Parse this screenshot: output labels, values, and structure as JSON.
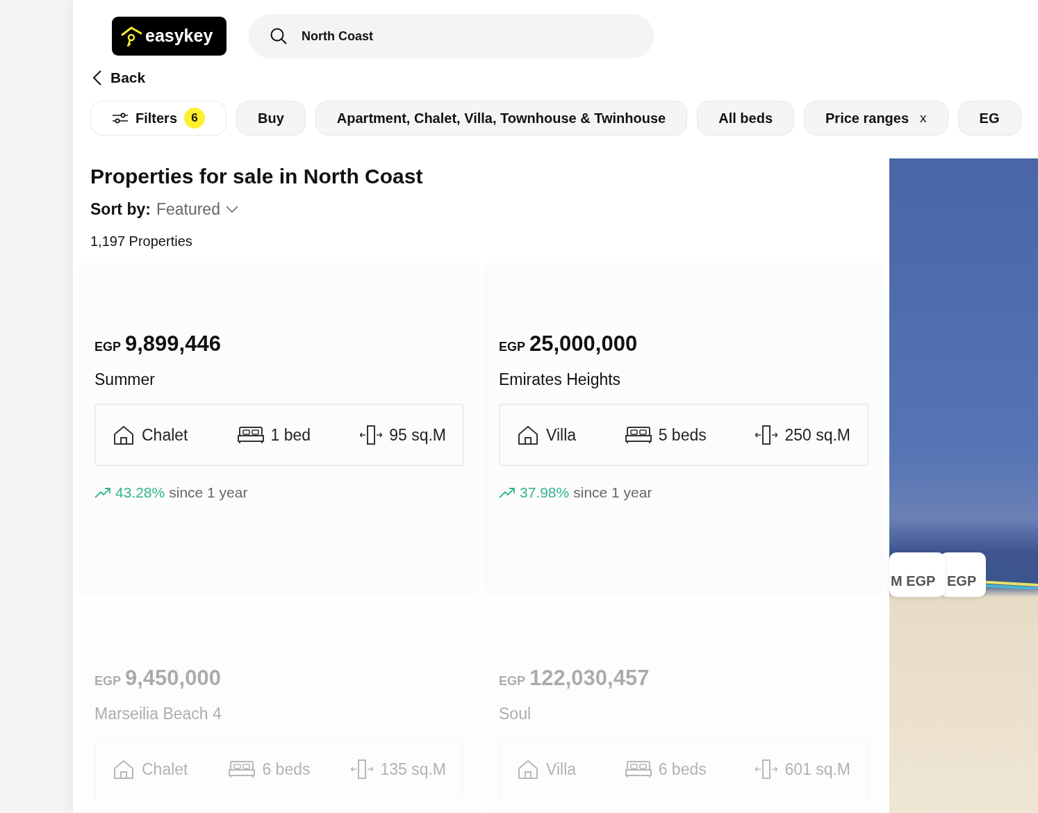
{
  "logo": {
    "text": "easykey"
  },
  "search": {
    "value": "North Coast"
  },
  "back": {
    "label": "Back"
  },
  "chips": [
    {
      "kind": "filters",
      "label": "Filters",
      "count": "6"
    },
    {
      "kind": "plain",
      "label": "Buy"
    },
    {
      "kind": "plain",
      "label": "Apartment, Chalet, Villa, Townhouse & Twinhouse"
    },
    {
      "kind": "plain",
      "label": "All beds"
    },
    {
      "kind": "clear",
      "label": "Price ranges",
      "clear": "x"
    },
    {
      "kind": "plain",
      "label": "EG"
    }
  ],
  "heading": "Properties for sale in North Coast",
  "sort": {
    "label": "Sort by:",
    "value": "Featured"
  },
  "count": "1,197 Properties",
  "listings": [
    {
      "currency": "EGP",
      "price": "9,899,446",
      "name": "Summer",
      "type": "Chalet",
      "beds": "1 bed",
      "area": "95 sq.M",
      "trend": "43.28%",
      "trend_note": "since 1 year",
      "faded": false
    },
    {
      "currency": "EGP",
      "price": "25,000,000",
      "name": "Emirates Heights",
      "type": "Villa",
      "beds": "5 beds",
      "area": "250 sq.M",
      "trend": "37.98%",
      "trend_note": "since 1 year",
      "faded": false
    },
    {
      "currency": "EGP",
      "price": "9,450,000",
      "name": "Marseilia Beach 4",
      "type": "Chalet",
      "beds": "6 beds",
      "area": "135 sq.M",
      "faded": true
    },
    {
      "currency": "EGP",
      "price": "122,030,457",
      "name": "Soul",
      "type": "Villa",
      "beds": "6 beds",
      "area": "601 sq.M",
      "faded": true
    }
  ],
  "map": {
    "pins": [
      "M EGP",
      "EGP"
    ]
  }
}
